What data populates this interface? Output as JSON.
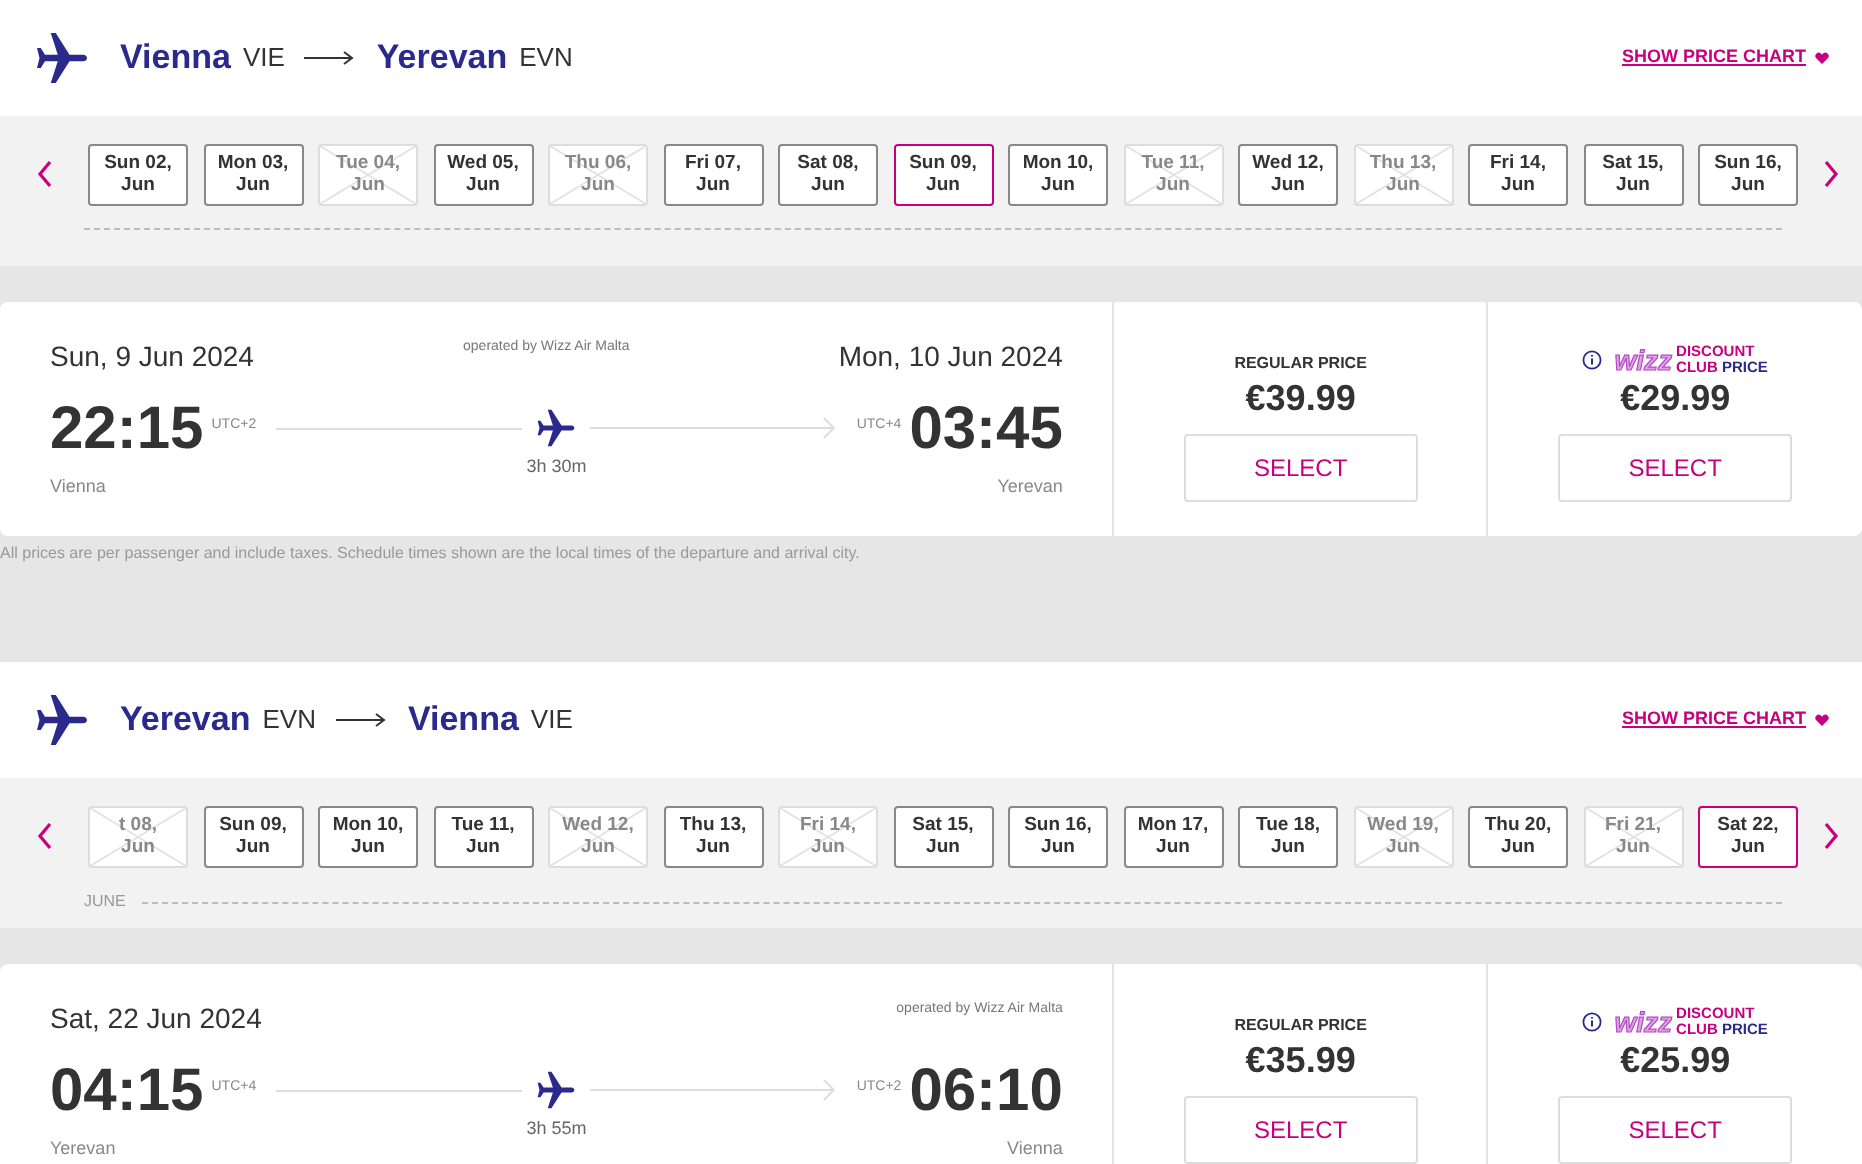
{
  "flights": [
    {
      "header": {
        "from_city": "Vienna",
        "from_code": "VIE",
        "to_city": "Yerevan",
        "to_code": "EVN",
        "price_chart_link": "SHOW PRICE CHART"
      },
      "dates": [
        {
          "day": "Sun 02,",
          "month": "Jun",
          "selected": false,
          "disabled": false
        },
        {
          "day": "Mon 03,",
          "month": "Jun",
          "selected": false,
          "disabled": false
        },
        {
          "day": "Tue 04,",
          "month": "Jun",
          "selected": false,
          "disabled": true
        },
        {
          "day": "Wed 05,",
          "month": "Jun",
          "selected": false,
          "disabled": false
        },
        {
          "day": "Thu 06,",
          "month": "Jun",
          "selected": false,
          "disabled": true
        },
        {
          "day": "Fri 07,",
          "month": "Jun",
          "selected": false,
          "disabled": false
        },
        {
          "day": "Sat 08,",
          "month": "Jun",
          "selected": false,
          "disabled": false
        },
        {
          "day": "Sun 09,",
          "month": "Jun",
          "selected": true,
          "disabled": false
        },
        {
          "day": "Mon 10,",
          "month": "Jun",
          "selected": false,
          "disabled": false
        },
        {
          "day": "Tue 11,",
          "month": "Jun",
          "selected": false,
          "disabled": true
        },
        {
          "day": "Wed 12,",
          "month": "Jun",
          "selected": false,
          "disabled": false
        },
        {
          "day": "Thu 13,",
          "month": "Jun",
          "selected": false,
          "disabled": true
        },
        {
          "day": "Fri 14,",
          "month": "Jun",
          "selected": false,
          "disabled": false
        },
        {
          "day": "Sat 15,",
          "month": "Jun",
          "selected": false,
          "disabled": false
        },
        {
          "day": "Sun 16,",
          "month": "Jun",
          "selected": false,
          "disabled": false
        }
      ],
      "card": {
        "departure_date": "Sun, 9 Jun 2024",
        "arrival_date": "Mon, 10 Jun 2024",
        "operator": "operated by Wizz Air Malta",
        "departure_time": "22:15",
        "departure_tz": "UTC+2",
        "arrival_time": "03:45",
        "arrival_tz": "UTC+4",
        "duration": "3h 30m",
        "departure_city": "Vienna",
        "arrival_city": "Yerevan",
        "prices": [
          {
            "kind": "regular",
            "label": "REGULAR PRICE",
            "price": "€39.99",
            "button": "SELECT"
          },
          {
            "kind": "club",
            "logo": "wizz",
            "label_top": "DISCOUNT",
            "label_bottom_1": "CLUB",
            "label_bottom_2": "PRICE",
            "price": "€29.99",
            "button": "SELECT"
          }
        ]
      },
      "note": "All prices are per passenger and include taxes. Schedule times shown are the local times of the departure and arrival city."
    },
    {
      "header": {
        "from_city": "Yerevan",
        "from_code": "EVN",
        "to_city": "Vienna",
        "to_code": "VIE",
        "price_chart_link": "SHOW PRICE CHART"
      },
      "month_label": "JUNE",
      "dates": [
        {
          "day": "t 08,",
          "month": "Jun",
          "selected": false,
          "disabled": true
        },
        {
          "day": "Sun 09,",
          "month": "Jun",
          "selected": false,
          "disabled": false
        },
        {
          "day": "Mon 10,",
          "month": "Jun",
          "selected": false,
          "disabled": false
        },
        {
          "day": "Tue 11,",
          "month": "Jun",
          "selected": false,
          "disabled": false
        },
        {
          "day": "Wed 12,",
          "month": "Jun",
          "selected": false,
          "disabled": true
        },
        {
          "day": "Thu 13,",
          "month": "Jun",
          "selected": false,
          "disabled": false
        },
        {
          "day": "Fri 14,",
          "month": "Jun",
          "selected": false,
          "disabled": true
        },
        {
          "day": "Sat 15,",
          "month": "Jun",
          "selected": false,
          "disabled": false
        },
        {
          "day": "Sun 16,",
          "month": "Jun",
          "selected": false,
          "disabled": false
        },
        {
          "day": "Mon 17,",
          "month": "Jun",
          "selected": false,
          "disabled": false
        },
        {
          "day": "Tue 18,",
          "month": "Jun",
          "selected": false,
          "disabled": false
        },
        {
          "day": "Wed 19,",
          "month": "Jun",
          "selected": false,
          "disabled": true
        },
        {
          "day": "Thu 20,",
          "month": "Jun",
          "selected": false,
          "disabled": false
        },
        {
          "day": "Fri 21,",
          "month": "Jun",
          "selected": false,
          "disabled": true
        },
        {
          "day": "Sat 22,",
          "month": "Jun",
          "selected": true,
          "disabled": false
        }
      ],
      "card": {
        "departure_date": "Sat, 22 Jun 2024",
        "operator": "operated by Wizz Air Malta",
        "departure_time": "04:15",
        "departure_tz": "UTC+4",
        "arrival_time": "06:10",
        "arrival_tz": "UTC+2",
        "duration": "3h 55m",
        "departure_city": "Yerevan",
        "arrival_city": "Vienna",
        "prices": [
          {
            "kind": "regular",
            "label": "REGULAR PRICE",
            "price": "€35.99",
            "button": "SELECT"
          },
          {
            "kind": "club",
            "logo": "wizz",
            "label_top": "DISCOUNT",
            "label_bottom_1": "CLUB",
            "label_bottom_2": "PRICE",
            "price": "€25.99",
            "button": "SELECT"
          }
        ]
      }
    }
  ]
}
